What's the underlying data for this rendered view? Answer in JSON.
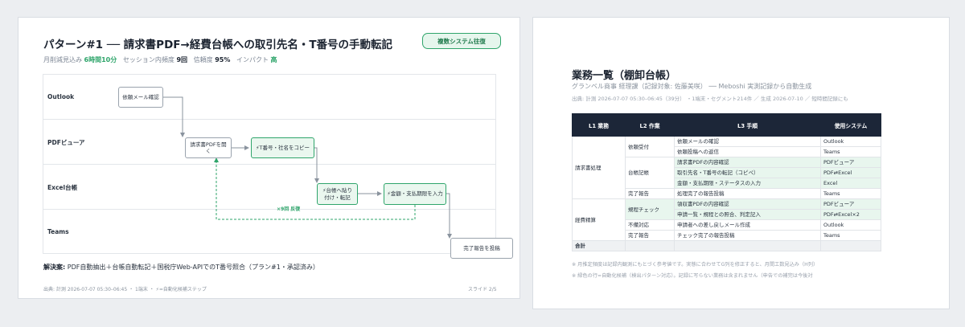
{
  "left": {
    "title": "パターン#1 ── 請求書PDF→経費台帳への取引先名・T番号の手動転記",
    "badge": "複数システム往復",
    "metrics": {
      "reduction_label": "月削減見込み",
      "reduction_value": "6時間10分",
      "frequency_label": "セッション内頻度",
      "frequency_value": "9回",
      "confidence_label": "信頼度",
      "confidence_value": "95%",
      "impact_label": "インパクト",
      "impact_value": "高"
    },
    "lanes": [
      "Outlook",
      "PDFビューア",
      "Excel台帳",
      "Teams"
    ],
    "steps": {
      "s1": "依頼メール確認",
      "s2": "請求書PDFを開く",
      "s3": "⚡T番号・社名をコピー",
      "s4": "⚡台帳へ貼り付け・転記",
      "s5": "⚡金額・支払期限を入力",
      "s6": "完了報告を投稿"
    },
    "loop_label": "×9回 反復",
    "solution_label": "解決案:",
    "solution_text": " PDF自動抽出＋台帳自動転記＋国税庁Web-APIでのT番号照合（プラン#1・承認済み）",
    "footer_left": "出典: 計測 2026-07-07 05:30–06:45 ・ 1端末 ・ ⚡=自動化候補ステップ",
    "footer_right": "スライド 2/5",
    "colors": {
      "accent": "#2fa56b",
      "auto_fill": "#eaf7ef"
    }
  },
  "right": {
    "title": "業務一覧（棚卸台帳）",
    "subtitle": "グランベル商事 経理課（記録対象: 佐藤美咲） ── Meboshi 実測記録から自動生成",
    "source": "出典: 計測 2026-07-07 05:30–06:45（39分） ・1端末・セグメント214件 ／ 生成 2026-07-10 ／ 短時間記録にも",
    "columns": [
      "L1 業務",
      "L2 作業",
      "L3 手順",
      "使用システム"
    ],
    "groups": [
      {
        "l1": "請求書処理",
        "subs": [
          {
            "l2": "依頼受付",
            "rows": [
              {
                "l3": "依頼メールの確認",
                "sys": "Outlook",
                "auto": false
              },
              {
                "l3": "依頼投稿への返信",
                "sys": "Teams",
                "auto": false
              }
            ]
          },
          {
            "l2": "台帳記帳",
            "rows": [
              {
                "l3": "請求書PDFの内容確認",
                "sys": "PDFビューア",
                "auto": true
              },
              {
                "l3": "取引先名・T番号の転記（コピペ）",
                "sys": "PDF⇄Excel",
                "auto": true
              },
              {
                "l3": "金額・支払期限・ステータスの入力",
                "sys": "Excel",
                "auto": true
              }
            ]
          },
          {
            "l2": "完了報告",
            "rows": [
              {
                "l3": "処理完了の報告投稿",
                "sys": "Teams",
                "auto": false
              }
            ]
          }
        ]
      },
      {
        "l1": "経費精算",
        "subs": [
          {
            "l2": "規程チェック",
            "rows": [
              {
                "l3": "領収書PDFの内容確認",
                "sys": "PDFビューア",
                "auto": true
              },
              {
                "l3": "申請一覧・規程との照合、判定記入",
                "sys": "PDF⇄Excel×2",
                "auto": true
              }
            ]
          },
          {
            "l2": "不備対応",
            "rows": [
              {
                "l3": "申請者への差し戻しメール作成",
                "sys": "Outlook",
                "auto": false
              }
            ]
          },
          {
            "l2": "完了報告",
            "rows": [
              {
                "l3": "チェック完了の報告投稿",
                "sys": "Teams",
                "auto": false
              }
            ]
          }
        ]
      }
    ],
    "total_label": "合計",
    "note1": "※ 月推定頻度は記録内観測にもとづく参考値です。実態に合わせてG列を修正すると、月間工数見込み（H列）",
    "note2": "※ 緑色の行=自動化候補（検出パターン対応）。記録に写らない業務は含まれません（申告での補完は今後対"
  }
}
